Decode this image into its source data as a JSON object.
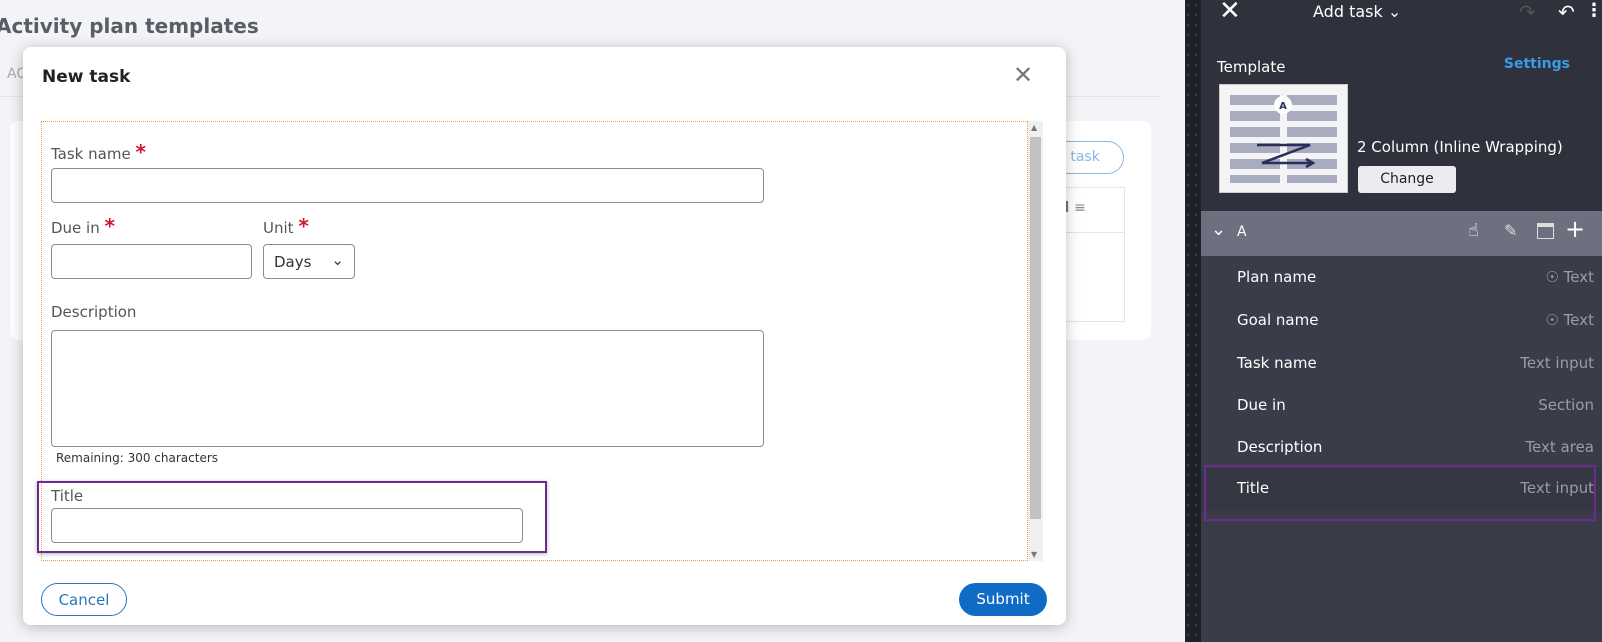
{
  "background": {
    "page_title": "Activity plan templates",
    "tab_partial": "AC",
    "add_task_partial": "d task",
    "table_header_partial": "ted"
  },
  "modal": {
    "title": "New task",
    "task_name_label": "Task name",
    "due_in_label": "Due in",
    "unit_label": "Unit",
    "unit_value": "Days",
    "description_label": "Description",
    "remaining": "Remaining: 300 characters",
    "title_label": "Title",
    "required_mark": "*",
    "cancel": "Cancel",
    "submit": "Submit"
  },
  "panel": {
    "header_title": "Add task",
    "template_label": "Template",
    "settings": "Settings",
    "template_name": "2 Column (Inline Wrapping)",
    "change": "Change",
    "region": "A",
    "rows": [
      {
        "name": "Plan name",
        "type": "Text",
        "icon": "eye"
      },
      {
        "name": "Goal name",
        "type": "Text",
        "icon": "eye"
      },
      {
        "name": "Task name",
        "type": "Text input"
      },
      {
        "name": "Due in",
        "type": "Section"
      },
      {
        "name": "Description",
        "type": "Text area"
      },
      {
        "name": "Title",
        "type": "Text input",
        "highlighted": true
      }
    ]
  },
  "colors": {
    "accent": "#0f6bc6",
    "highlight": "#6a2c8f",
    "settings_link": "#3a9be8",
    "required": "#d4142a"
  }
}
